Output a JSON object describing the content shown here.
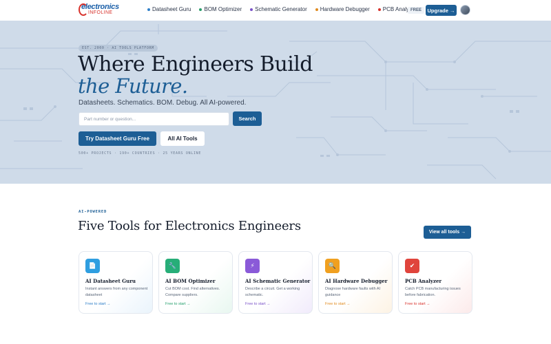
{
  "nav": {
    "logo_line1": "electronics",
    "logo_line2": "INFOLINE",
    "links": [
      {
        "label": "Datasheet Guru",
        "color": "#2f7fc8"
      },
      {
        "label": "BOM Optimizer",
        "color": "#2a9d6a"
      },
      {
        "label": "Schematic Generator",
        "color": "#7a52c8"
      },
      {
        "label": "Hardware Debugger",
        "color": "#e08a1e"
      },
      {
        "label": "PCB Analyzer",
        "color": "#d8322c"
      }
    ],
    "free_badge": "FREE",
    "upgrade_label": "Upgrade →"
  },
  "hero": {
    "kicker": "EST. 2000 · AI TOOLS PLATFORM",
    "title_line1": "Where Engineers Build",
    "title_line2": "the Future.",
    "tagline": "Datasheets. Schematics. BOM. Debug. All AI-powered.",
    "search_placeholder": "Part number or question...",
    "search_button": "Search",
    "cta_primary": "Try Datasheet Guru Free",
    "cta_secondary": "All AI Tools",
    "stats": "500+ PROJECTS   ·   190+ COUNTRIES   ·   25 YEARS ONLINE"
  },
  "tools_section": {
    "kicker": "AI-POWERED",
    "title": "Five Tools for Electronics Engineers",
    "view_all": "View all tools →",
    "cards": [
      {
        "title": "AI Datasheet Guru",
        "desc": "Instant answers from any component datasheet",
        "link": "Free to start →",
        "color": "#2f9ee0",
        "icon": "document-icon",
        "glyph": "📄"
      },
      {
        "title": "AI BOM Optimizer",
        "desc": "Cut BOM cost. Find alternatives. Compare suppliers.",
        "link": "Free to start →",
        "color": "#27ae78",
        "icon": "wrench-icon",
        "glyph": "🔧"
      },
      {
        "title": "AI Schematic Generator",
        "desc": "Describe a circuit. Get a working schematic.",
        "link": "Free to start →",
        "color": "#8a5ad8",
        "icon": "lightning-icon",
        "glyph": "⚡"
      },
      {
        "title": "AI Hardware Debugger",
        "desc": "Diagnose hardware faults with AI guidance",
        "link": "Free to start →",
        "color": "#f0a020",
        "icon": "magnifier-icon",
        "glyph": "🔍"
      },
      {
        "title": "PCB Analyzer",
        "desc": "Catch PCB manufacturing issues before fabrication.",
        "link": "Free to start →",
        "color": "#e0443c",
        "icon": "checkmark-icon",
        "glyph": "✔"
      }
    ]
  }
}
